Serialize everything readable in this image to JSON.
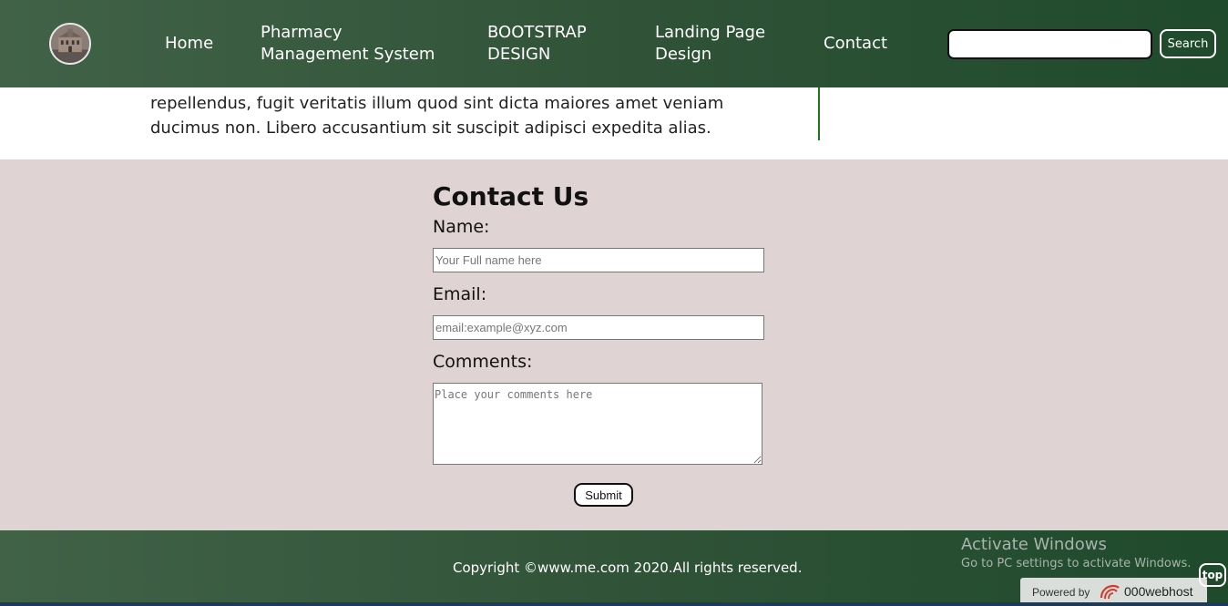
{
  "nav": {
    "items": [
      {
        "label": "Home"
      },
      {
        "label": "Pharmacy Management System"
      },
      {
        "label": "BOOTSTRAP DESIGN"
      },
      {
        "label": "Landing Page Design"
      },
      {
        "label": "Contact"
      }
    ],
    "search_button": "Search",
    "search_value": ""
  },
  "article": {
    "text": "Lorem ipsum dolor sit amet consectetur adipisicing elit. Quisquam quos repellendus, fugit veritatis illum quod sint dicta maiores amet veniam ducimus non. Libero accusantium sit suscipit adipisci expedita alias."
  },
  "contact": {
    "title": "Contact Us",
    "name_label": "Name:",
    "name_placeholder": "Your Full name here",
    "email_label": "Email:",
    "email_placeholder": "email:example@xyz.com",
    "comments_label": "Comments:",
    "comments_placeholder": "Place your comments here",
    "submit_label": "Submit"
  },
  "footer": {
    "copyright": "Copyright ©www.me.com 2020.All rights reserved.",
    "top_button": "top"
  },
  "overlay": {
    "activate_title": "Activate Windows",
    "activate_sub": "Go to PC settings to activate Windows.",
    "powered_label": "Powered by",
    "powered_brand": "000webhost"
  },
  "colors": {
    "nav_bg": "#2f5237",
    "contact_bg": "#dfd3d3",
    "divider": "#1a7a1a"
  }
}
